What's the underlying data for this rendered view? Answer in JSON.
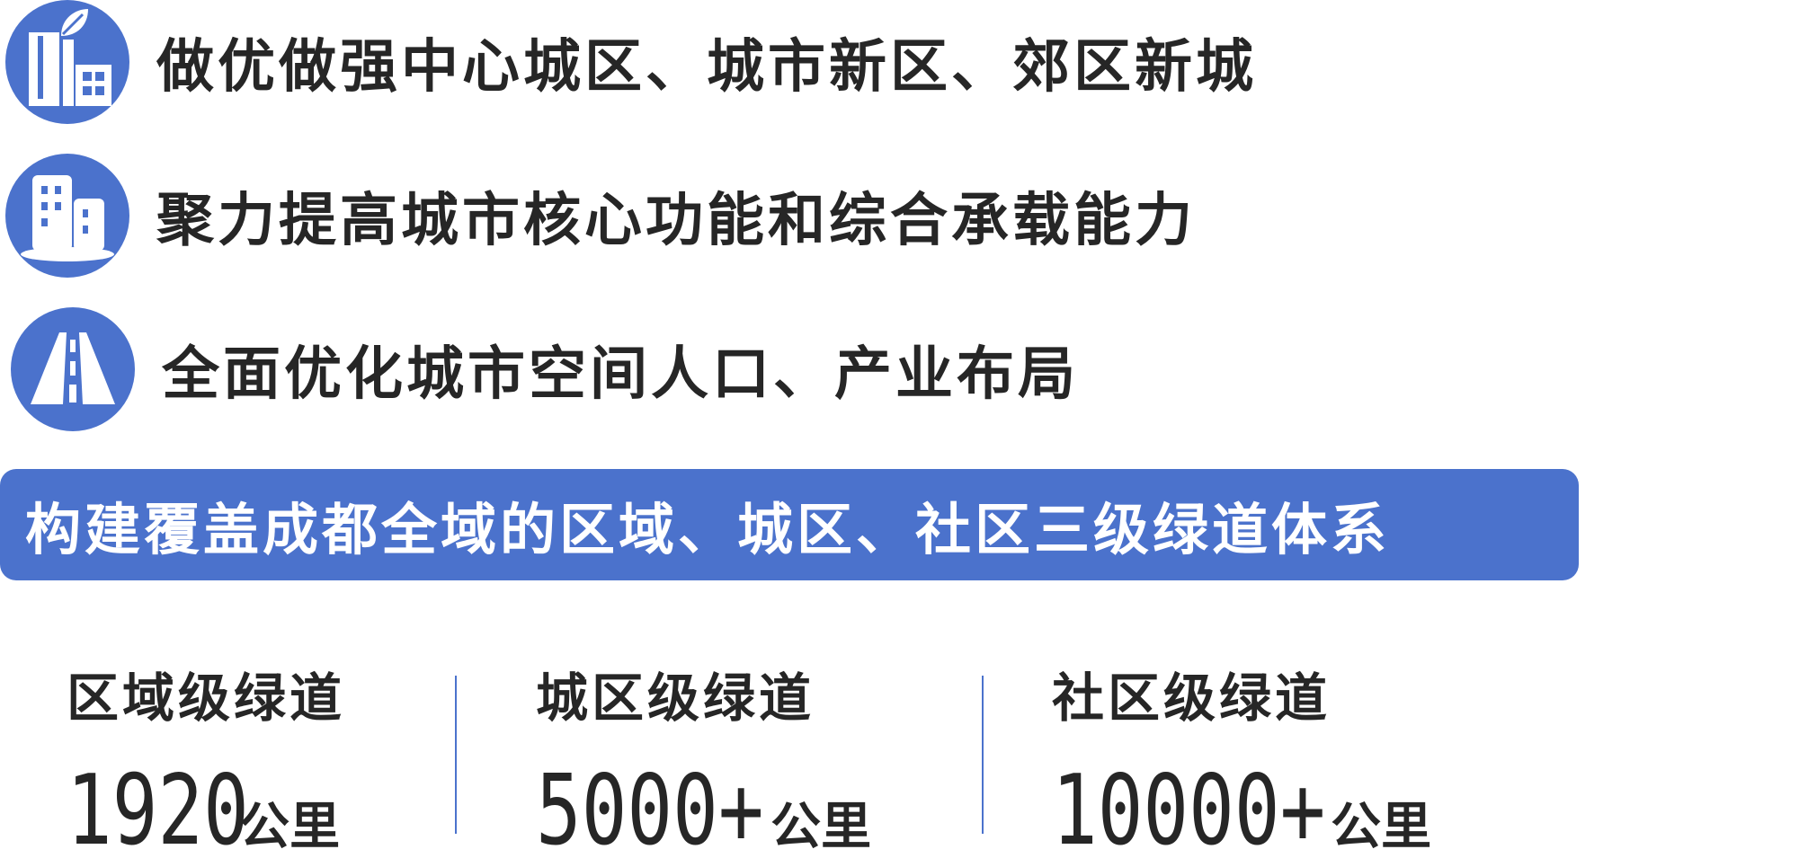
{
  "rows": [
    {
      "text": "做优做强中心城区、城市新区、郊区新城",
      "icon": "city-leaf-icon"
    },
    {
      "text": "聚力提高城市核心功能和综合承载能力",
      "icon": "buildings-icon"
    },
    {
      "text": "全面优化城市空间人口、产业布局",
      "icon": "road-icon"
    }
  ],
  "banner": {
    "text": "构建覆盖成都全域的区域、城区、社区三级绿道体系"
  },
  "stats": [
    {
      "label": "区域级绿道",
      "value": "1920",
      "unit": "公里"
    },
    {
      "label": "城区级绿道",
      "value": "5000+",
      "unit": "公里"
    },
    {
      "label": "社区级绿道",
      "value": "10000+",
      "unit": "公里"
    }
  ],
  "colors": {
    "accent": "#4b72cc",
    "text": "#262626",
    "banner_text": "#ffffff"
  }
}
